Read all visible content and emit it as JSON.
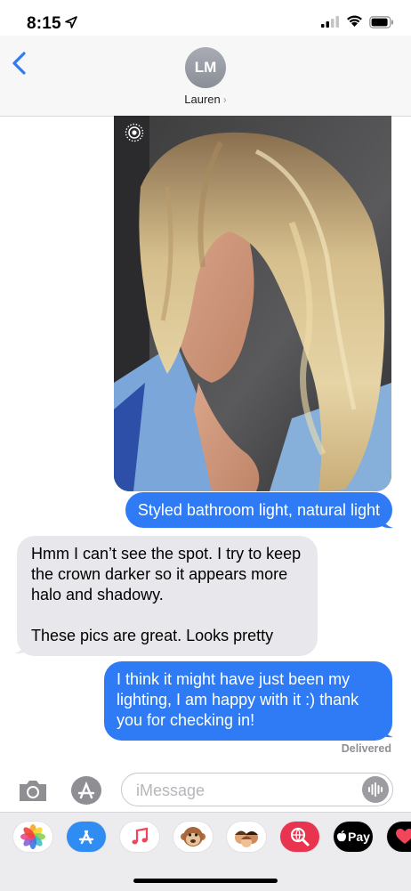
{
  "status": {
    "time": "8:15"
  },
  "header": {
    "initials": "LM",
    "contact_name": "Lauren",
    "chevron": "›"
  },
  "photo": {
    "description_icon": "live-photo-icon"
  },
  "messages": [
    {
      "dir": "out",
      "text": "Styled bathroom light, natural light"
    },
    {
      "dir": "in",
      "text": "Hmm I can’t see the spot. I try to keep the crown darker so it appears more halo and shadowy.\n\nThese pics are great. Looks pretty"
    },
    {
      "dir": "out",
      "text": "I think it might have just been my lighting, I am happy with it :) thank you for checking in!"
    }
  ],
  "delivered": "Delivered",
  "input": {
    "placeholder": "iMessage",
    "value": ""
  },
  "drawer": {
    "apps": [
      "photos-app",
      "app-store-app",
      "music-app",
      "animoji-app",
      "memoji-app",
      "search-images-app",
      "apple-pay-app",
      "digital-touch-app"
    ],
    "apple_pay_label": "Pay"
  },
  "colors": {
    "outgoing": "#2f7bf5",
    "incoming": "#e8e8ec",
    "accent": "#2f7bf5"
  }
}
